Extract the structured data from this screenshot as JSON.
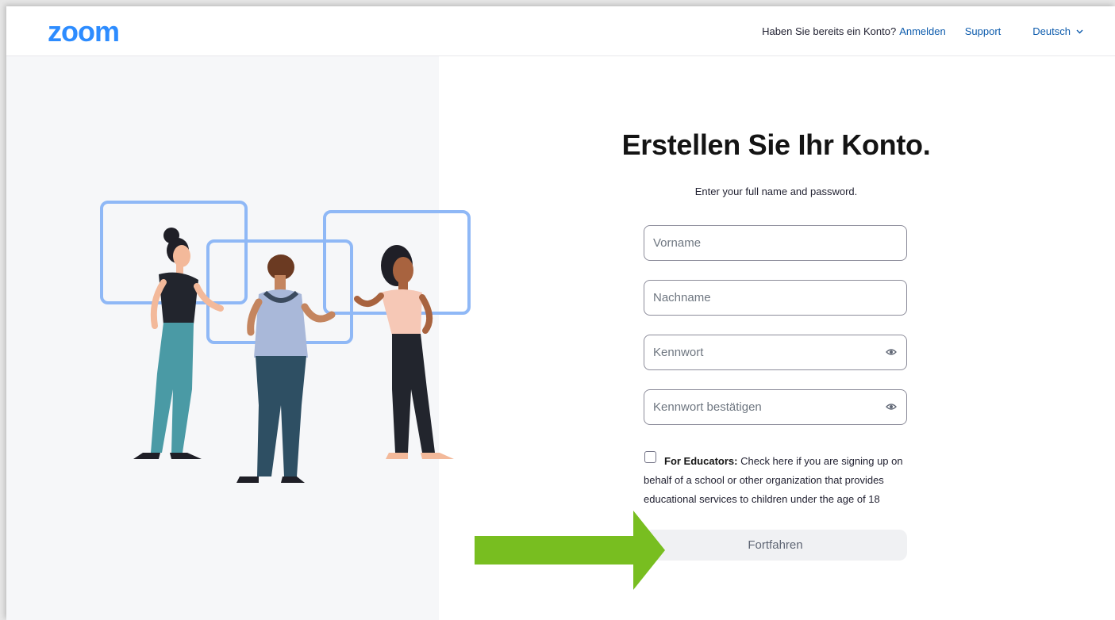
{
  "brand": {
    "logo_text": "zoom",
    "color": "#2D8CFF"
  },
  "nav": {
    "already_text": "Haben Sie bereits ein Konto?",
    "signin_label": "Anmelden",
    "support_label": "Support",
    "language_label": "Deutsch",
    "link_color": "#0E5CAD"
  },
  "form": {
    "title": "Erstellen Sie Ihr Konto.",
    "subtitle": "Enter your full name and password.",
    "first_name_placeholder": "Vorname",
    "last_name_placeholder": "Nachname",
    "password_placeholder": "Kennwort",
    "confirm_password_placeholder": "Kennwort bestätigen",
    "educator_label": "For Educators:",
    "educator_text": "Check here if you are signing up on behalf of a school or other organization that provides educational services to children under the age of 18",
    "continue_label": "Fortfahren"
  },
  "icons": {
    "password_toggle": "eye-icon",
    "language_chevron": "chevron-down-icon",
    "annotation": "green-arrow-icon"
  },
  "colors": {
    "arrow": "#78BE20",
    "frame_accent": "#8FB8F6"
  }
}
